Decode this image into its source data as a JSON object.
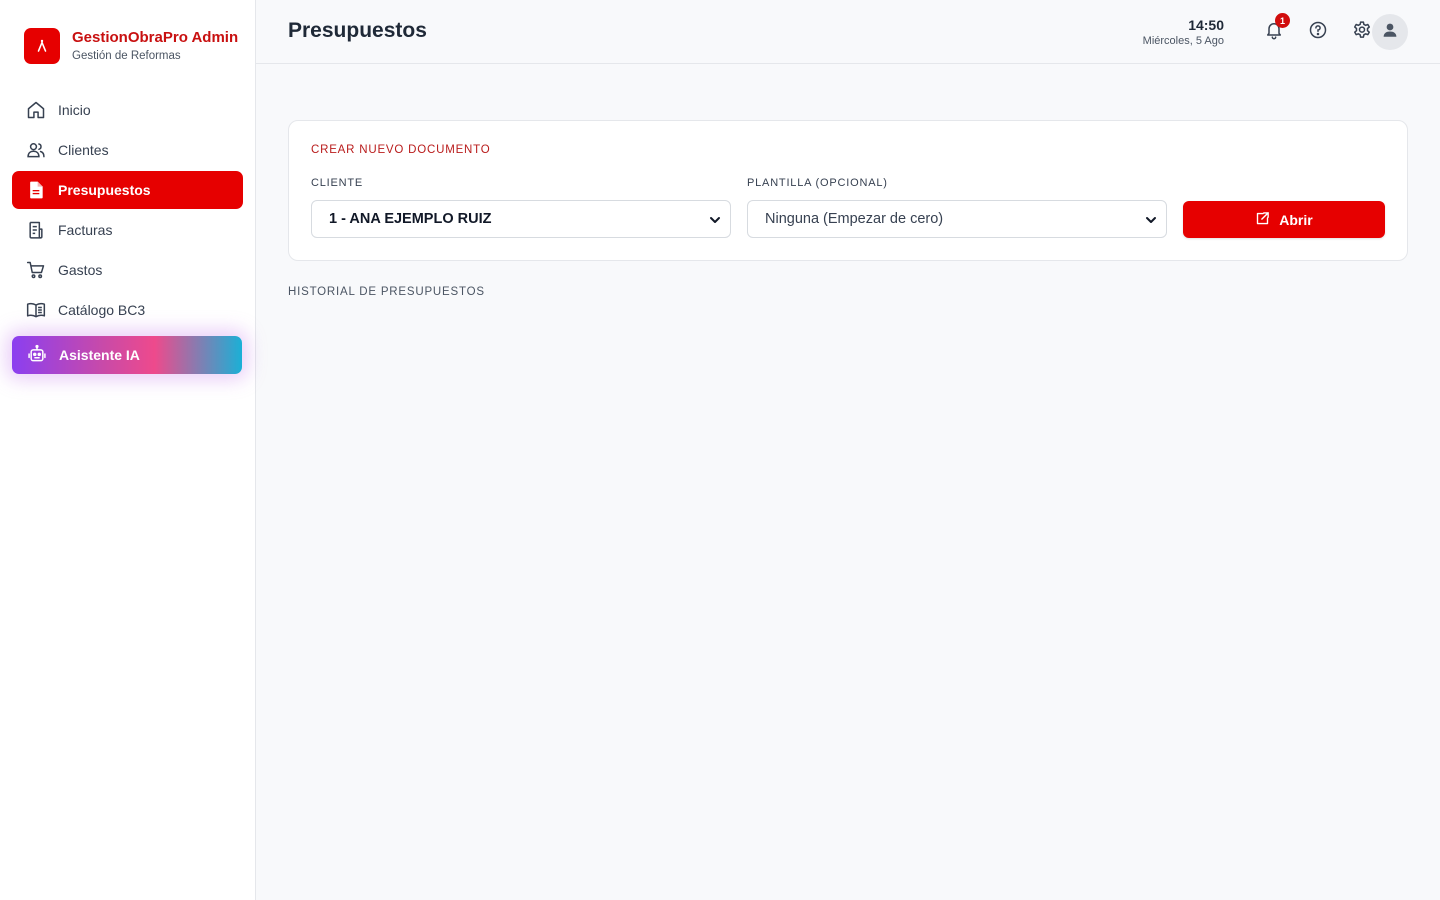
{
  "brand": {
    "title": "GestionObraPro Admin",
    "subtitle": "Gestión de Reformas"
  },
  "sidebar": {
    "items": [
      {
        "label": "Inicio",
        "icon": "home-icon"
      },
      {
        "label": "Clientes",
        "icon": "users-icon"
      },
      {
        "label": "Presupuestos",
        "icon": "document-icon",
        "active": true
      },
      {
        "label": "Facturas",
        "icon": "receipt-icon"
      },
      {
        "label": "Gastos",
        "icon": "cart-icon"
      },
      {
        "label": "Catálogo BC3",
        "icon": "book-icon"
      }
    ],
    "ai": {
      "label": "Asistente IA",
      "icon": "robot-icon"
    }
  },
  "header": {
    "title": "Presupuestos",
    "time": "14:50",
    "date": "Miércoles, 5 Ago",
    "notifications_count": "1"
  },
  "create_card": {
    "title": "CREAR NUEVO DOCUMENTO",
    "client_label": "CLIENTE",
    "client_value": "1 - ANA EJEMPLO RUIZ",
    "template_label": "PLANTILLA (OPCIONAL)",
    "template_value": "Ninguna (Empezar de cero)",
    "open_button": "Abrir"
  },
  "history": {
    "title": "HISTORIAL DE PRESUPUESTOS"
  },
  "colors": {
    "accent": "#e60000",
    "brand_text": "#c81010",
    "badge": "#d10d0d"
  }
}
